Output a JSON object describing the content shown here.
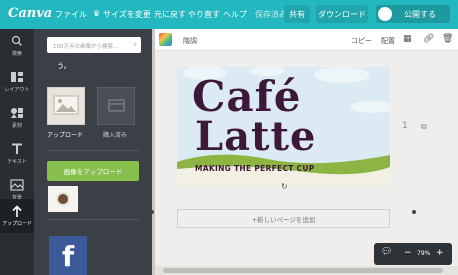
{
  "topbar": {
    "logo": "Canva",
    "menu": [
      "ファイル",
      "サイズを変更",
      "元に戻す",
      "やり直す",
      "ヘルプ",
      "保存済み"
    ],
    "share": "共有",
    "download": "ダウンロード",
    "publish": "公開する"
  },
  "leftnav": [
    {
      "label": "検索",
      "icon": "search-icon"
    },
    {
      "label": "レイアウト",
      "icon": "layout-icon"
    },
    {
      "label": "素材",
      "icon": "elements-icon"
    },
    {
      "label": "テキスト",
      "icon": "text-icon"
    },
    {
      "label": "背景",
      "icon": "background-icon"
    },
    {
      "label": "アップロード",
      "icon": "upload-icon"
    }
  ],
  "panel": {
    "search_placeholder": "100万点の画像から検索…",
    "partial_text": "う。",
    "tiles": [
      {
        "label": "アップロード"
      },
      {
        "label": "購入済み"
      }
    ],
    "upload_button": "画像をアップロード"
  },
  "canvas_toolbar": {
    "font": "階調",
    "copy": "コピー",
    "arrange": "配置"
  },
  "design": {
    "line1": "Café",
    "line2": "Latte",
    "subtitle": "MAKING THE PERFECT CUP",
    "colors": {
      "title": "#3d1839",
      "green": "#8db543",
      "sky": "#dbeaf3"
    }
  },
  "page": {
    "number": "1",
    "add_page": "+新しいページを追加"
  },
  "zoom": {
    "value": "79%"
  }
}
